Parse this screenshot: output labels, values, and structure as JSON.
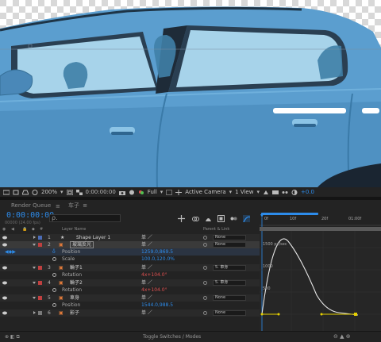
{
  "viewer": {
    "zoom": "200%",
    "timecode": "0:00:00:00",
    "resolution": "Full",
    "camera": "Active Camera",
    "view": "1 View",
    "exposure": "+0.0"
  },
  "tabs": {
    "render_queue": "Render Queue",
    "comp": "车子"
  },
  "timeline": {
    "current_time": "0:00:00:00",
    "fps": "00000 (24.00 fps)",
    "search_placeholder": "ρ.",
    "columns": {
      "layer_name": "Layer Name",
      "parent_link": "Parent & Link"
    },
    "ruler": {
      "t0": "0f",
      "t1": "10f",
      "t2": "20f",
      "t3": "01:00f"
    },
    "graph_labels": {
      "y1500": "1500 px/sec",
      "y1000": "1000",
      "y500": "500"
    }
  },
  "layers": [
    {
      "num": "1",
      "name": "Shape Layer 1",
      "switch": "单 ／",
      "parent": "None",
      "label_color": "#4b6cb7",
      "kind": "layer"
    },
    {
      "num": "2",
      "name": "玻璃反光",
      "switch": "单 ／",
      "parent": "None",
      "label_color": "#c04040",
      "kind": "layer",
      "selected": true
    },
    {
      "prop": "Position",
      "value": "1259.0,869.5",
      "red": false
    },
    {
      "prop": "Scale",
      "value": "100.0,120.0%",
      "red": false
    },
    {
      "num": "3",
      "name": "輪子1",
      "switch": "单 ／",
      "parent": "5. 車身",
      "label_color": "#c04040",
      "kind": "layer"
    },
    {
      "prop": "Rotation",
      "value": "4x+104.0°",
      "red": true
    },
    {
      "num": "4",
      "name": "輪子2",
      "switch": "单 ／",
      "parent": "5. 車身",
      "label_color": "#c04040",
      "kind": "layer"
    },
    {
      "prop": "Rotation",
      "value": "4x+104.0°",
      "red": true
    },
    {
      "num": "5",
      "name": "車身",
      "switch": "单 ／",
      "parent": "None",
      "label_color": "#c04040",
      "kind": "layer"
    },
    {
      "prop": "Position",
      "value": "1544.0,988.5",
      "red": false
    },
    {
      "num": "6",
      "name": "影子",
      "switch": "单 ／",
      "parent": "None",
      "label_color": "#7a7a7a",
      "kind": "layer"
    }
  ],
  "bottom": {
    "toggle_label": "Toggle Switches / Modes"
  }
}
